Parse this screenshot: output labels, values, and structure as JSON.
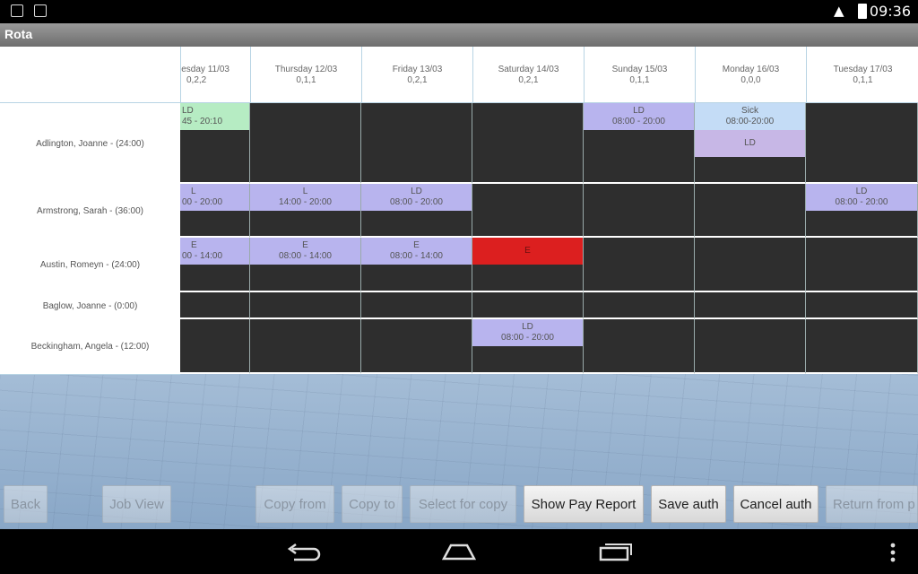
{
  "status": {
    "time": "09:36"
  },
  "app": {
    "title": "Rota"
  },
  "days": [
    {
      "name": "esday 11/03",
      "counts": "0,2,2"
    },
    {
      "name": "Thursday 12/03",
      "counts": "0,1,1"
    },
    {
      "name": "Friday 13/03",
      "counts": "0,2,1"
    },
    {
      "name": "Saturday 14/03",
      "counts": "0,2,1"
    },
    {
      "name": "Sunday 15/03",
      "counts": "0,1,1"
    },
    {
      "name": "Monday 16/03",
      "counts": "0,0,0"
    },
    {
      "name": "Tuesday 17/03",
      "counts": "0,1,1"
    }
  ],
  "staff": [
    {
      "name": "Adlington, Joanne - (24:00)"
    },
    {
      "name": "Armstrong, Sarah - (36:00)"
    },
    {
      "name": "Austin, Romeyn - (24:00)"
    },
    {
      "name": "Baglow, Joanne - (0:00)"
    },
    {
      "name": "Beckingham, Angela - (12:00)"
    }
  ],
  "shifts": {
    "r0d0": {
      "code": "LD",
      "time": "45 - 20:10"
    },
    "r0d4": {
      "code": "LD",
      "time": "08:00 - 20:00"
    },
    "r0d5a": {
      "code": "Sick",
      "time": "08:00-20:00"
    },
    "r0d5b": {
      "code": "LD",
      "time": ""
    },
    "r1d0": {
      "code": "L",
      "time": "00 - 20:00"
    },
    "r1d1": {
      "code": "L",
      "time": "14:00 - 20:00"
    },
    "r1d2": {
      "code": "LD",
      "time": "08:00 - 20:00"
    },
    "r1d6": {
      "code": "LD",
      "time": "08:00 - 20:00"
    },
    "r2d0": {
      "code": "E",
      "time": "00 - 14:00"
    },
    "r2d1": {
      "code": "E",
      "time": "08:00 - 14:00"
    },
    "r2d2": {
      "code": "E",
      "time": "08:00 - 14:00"
    },
    "r2d3": {
      "code": "E",
      "time": ""
    },
    "r4d3": {
      "code": "LD",
      "time": "08:00 - 20:00"
    }
  },
  "buttons": {
    "back": "Back",
    "job_view": "Job View",
    "copy_from": "Copy from",
    "copy_to": "Copy to",
    "select_for_copy": "Select for copy",
    "show_pay_report": "Show Pay Report",
    "save_auth": "Save auth",
    "cancel_auth": "Cancel auth",
    "return_from": "Return from p"
  },
  "colors": {
    "ld_green": "#b6ecc3",
    "shift_purple": "#b8b4ee",
    "sick_blue": "#c4dcf6",
    "early_red": "#dc1f1f",
    "empty_cell": "#2e2e2e"
  }
}
